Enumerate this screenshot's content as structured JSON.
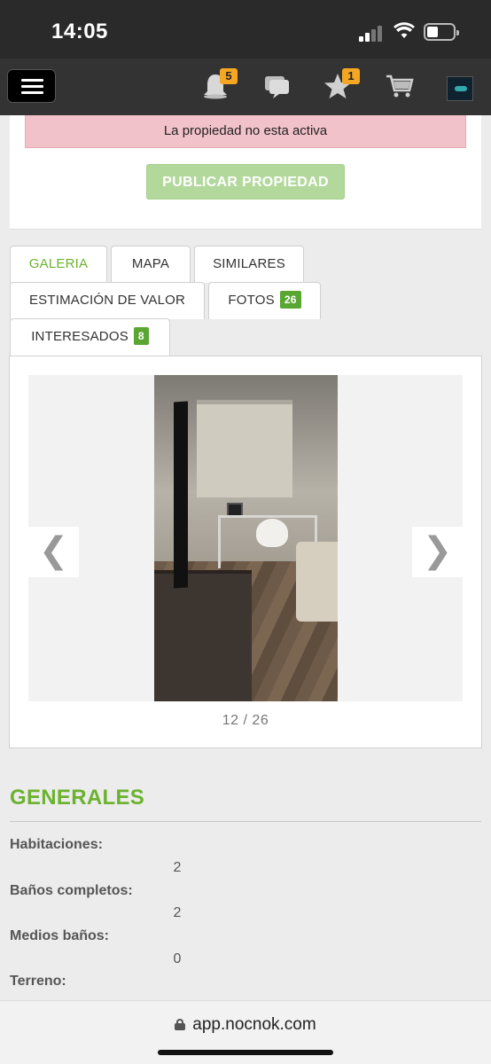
{
  "status_bar": {
    "time": "14:05"
  },
  "navbar": {
    "notifications_count": "5",
    "favorites_count": "1"
  },
  "alert": {
    "text": "La propiedad no esta activa"
  },
  "publish_button": {
    "label": "PUBLICAR PROPIEDAD"
  },
  "tabs": [
    {
      "label": "GALERIA",
      "active": true
    },
    {
      "label": "MAPA"
    },
    {
      "label": "SIMILARES"
    },
    {
      "label": "ESTIMACIÓN DE VALOR"
    },
    {
      "label": "FOTOS",
      "badge": "26"
    },
    {
      "label": "INTERESADOS",
      "badge": "8"
    }
  ],
  "gallery": {
    "prev_icon": "❮",
    "next_icon": "❯",
    "counter": "12 / 26"
  },
  "generales": {
    "title": "GENERALES",
    "properties": [
      {
        "label": "Habitaciones:",
        "value": "2"
      },
      {
        "label": "Baños completos:",
        "value": "2"
      },
      {
        "label": "Medios baños:",
        "value": "0"
      },
      {
        "label": "Terreno:",
        "value": ""
      }
    ]
  },
  "browser": {
    "url": "app.nocnok.com"
  },
  "colors": {
    "accent_green": "#6bb22e",
    "badge_orange": "#f5a623",
    "alert_pink": "#f2c2ca",
    "publish_green": "#b2d89c"
  }
}
